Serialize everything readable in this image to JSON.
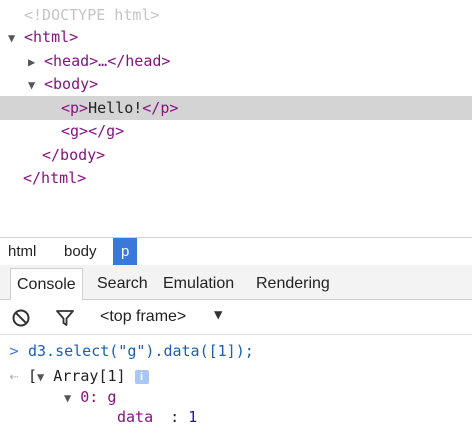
{
  "elements": {
    "doctype": "<!DOCTYPE html>",
    "html_open": "<html>",
    "head": "<head>…</head>",
    "body_open": "<body>",
    "p_open": "<p>",
    "p_text": "Hello!",
    "p_close": "</p>",
    "g_open": "<g>",
    "g_close": "</g>",
    "body_close": "</body>",
    "html_close": "</html>"
  },
  "breadcrumbs": [
    "html",
    "body",
    "p"
  ],
  "tabs": [
    "Console",
    "Search",
    "Emulation",
    "Rendering"
  ],
  "toolbar": {
    "frame": "<top frame>"
  },
  "console": {
    "command": "d3.select(\"g\").data([1]);",
    "result_label": "Array[1]",
    "item_key": "0:",
    "item_value": "g",
    "data_key": "data",
    "data_sep": ":",
    "data_value": "1"
  },
  "colors": {
    "selection": "#d4d4d4",
    "tag": "#881280",
    "accent": "#3879d9"
  }
}
